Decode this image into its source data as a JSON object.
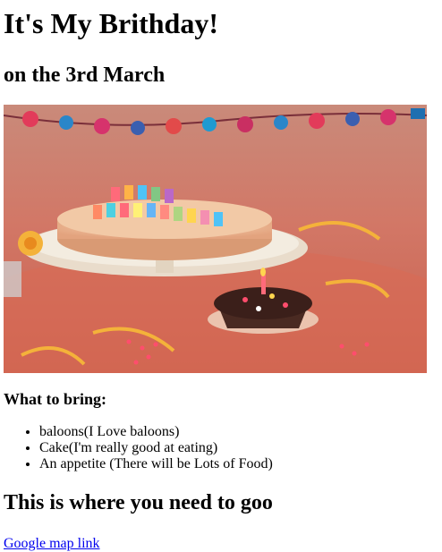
{
  "page": {
    "title": "It's My Brithday!",
    "subtitle": "on the 3rd March",
    "image": {
      "semantic": "birthday-cake-photo",
      "colors": {
        "background": "#d9735f",
        "wall": "#c98a7a",
        "plate": "#ece3d2",
        "cake": "#f0c09a",
        "cupcake": "#3b1f1a",
        "candle": "#ff6a7a",
        "streamer": "#f4b23a",
        "sprinkle": "#ff4d6d"
      }
    },
    "bring_heading": "What to bring:",
    "bring_items": [
      "baloons(I Love baloons)",
      "Cake(I'm really good at eating)",
      "An appetite (There will be Lots of Food)"
    ],
    "where_heading": "This is where you need to goo",
    "map_link_text": "Google map link",
    "link_color": "#0000ee"
  }
}
